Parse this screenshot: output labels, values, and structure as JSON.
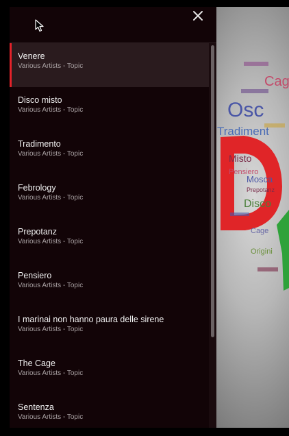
{
  "playlist": {
    "items": [
      {
        "title": "Venere",
        "subtitle": "Various Artists - Topic",
        "active": true
      },
      {
        "title": "Disco misto",
        "subtitle": "Various Artists - Topic",
        "active": false
      },
      {
        "title": "Tradimento",
        "subtitle": "Various Artists - Topic",
        "active": false
      },
      {
        "title": "Febrology",
        "subtitle": "Various Artists - Topic",
        "active": false
      },
      {
        "title": "Prepotanz",
        "subtitle": "Various Artists - Topic",
        "active": false
      },
      {
        "title": "Pensiero",
        "subtitle": "Various Artists - Topic",
        "active": false
      },
      {
        "title": "I marinai non hanno paura delle sirene",
        "subtitle": "Various Artists - Topic",
        "active": false
      },
      {
        "title": "The Cage",
        "subtitle": "Various Artists - Topic",
        "active": false
      },
      {
        "title": "Sentenza",
        "subtitle": "Various Artists - Topic",
        "active": false
      }
    ]
  },
  "colors": {
    "panel_bg": "#120407",
    "active_row_bg": "#2a1b1e",
    "accent": "#e4222a",
    "title_text": "#f1f1f1",
    "subtitle_text": "#a8a0a2"
  },
  "icons": {
    "close": "close-icon",
    "cursor": "mouse-cursor-icon"
  },
  "video": {
    "word_cloud": [
      "Osc",
      "Tradiment",
      "Cag",
      "Misto",
      "Pensiero",
      "Mosca",
      "Disco",
      "Prepotanz",
      "Cage",
      "Origini"
    ]
  }
}
